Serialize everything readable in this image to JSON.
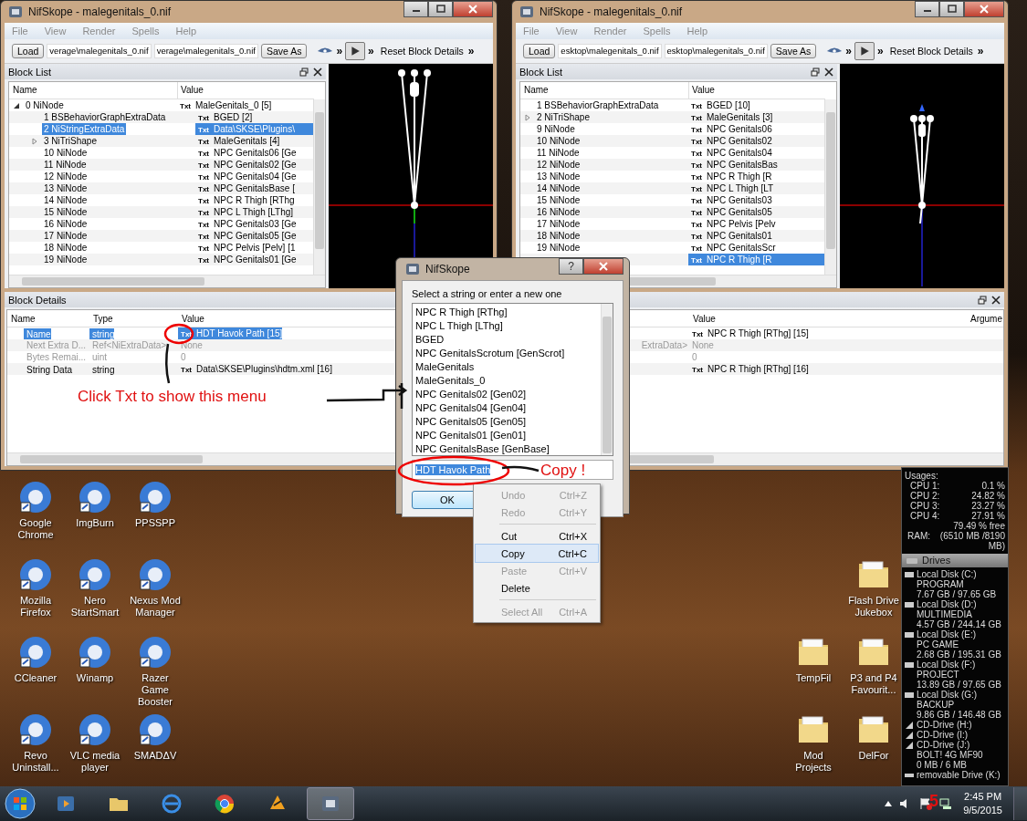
{
  "windows": [
    {
      "title": "NifSkope - malegenitals_0.nif",
      "menu": [
        "File",
        "View",
        "Render",
        "Spells",
        "Help"
      ],
      "toolbar": {
        "load": "Load",
        "path_1": "verage\\malegenitals_0.nif",
        "path_2": "verage\\malegenitals_0.nif",
        "save_as": "Save As",
        "reset": "Reset Block Details",
        "chevrons": [
          "»",
          "»",
          "»"
        ]
      },
      "block_list": {
        "title": "Block List",
        "columns": [
          "Name",
          "Value"
        ],
        "rows": [
          {
            "label": "0 NiNode",
            "value": "MaleGenitals_0 [5]",
            "badge": "Txt",
            "selected": false,
            "expanded": true,
            "children": [
              {
                "label": "1 BSBehaviorGraphExtraData",
                "value": "BGED [2]",
                "badge": "Txt",
                "selected": false
              },
              {
                "label": "2 NiStringExtraData",
                "value": "Data\\SKSE\\Plugins\\",
                "badge": "Txt",
                "selected": true
              },
              {
                "label": "3 NiTriShape",
                "value": "MaleGenitals [4]",
                "badge": "Txt",
                "selected": false,
                "expanded": false
              },
              {
                "label": "10 NiNode",
                "value": "NPC Genitals06 [Ge",
                "badge": "Txt",
                "selected": false
              },
              {
                "label": "11 NiNode",
                "value": "NPC Genitals02 [Ge",
                "badge": "Txt",
                "selected": false
              },
              {
                "label": "12 NiNode",
                "value": "NPC Genitals04 [Ge",
                "badge": "Txt",
                "selected": false
              },
              {
                "label": "13 NiNode",
                "value": "NPC GenitalsBase [",
                "badge": "Txt",
                "selected": false
              },
              {
                "label": "14 NiNode",
                "value": "NPC R Thigh [RThg",
                "badge": "Txt",
                "selected": false
              },
              {
                "label": "15 NiNode",
                "value": "NPC L Thigh [LThg]",
                "badge": "Txt",
                "selected": false
              },
              {
                "label": "16 NiNode",
                "value": "NPC Genitals03 [Ge",
                "badge": "Txt",
                "selected": false
              },
              {
                "label": "17 NiNode",
                "value": "NPC Genitals05 [Ge",
                "badge": "Txt",
                "selected": false
              },
              {
                "label": "18 NiNode",
                "value": "NPC Pelvis [Pelv] [1",
                "badge": "Txt",
                "selected": false
              },
              {
                "label": "19 NiNode",
                "value": "NPC Genitals01 [Ge",
                "badge": "Txt",
                "selected": false
              }
            ]
          }
        ]
      },
      "block_details": {
        "title": "Block Details",
        "columns": [
          {
            "kind": "name",
            "label": "Name"
          },
          {
            "kind": "type",
            "label": "Type"
          },
          {
            "kind": "value",
            "label": "Value"
          }
        ],
        "rows": [
          {
            "name": "Name",
            "type": "string",
            "value": "HDT Havok Path [15]",
            "badge": "Txt",
            "selected": true,
            "disabled": false
          },
          {
            "name": "Next Extra D...",
            "type": "Ref<NiExtraData>",
            "value": "None",
            "selected": false,
            "disabled": true
          },
          {
            "name": "Bytes Remai...",
            "type": "uint",
            "value": "0",
            "selected": false,
            "disabled": true
          },
          {
            "name": "String Data",
            "type": "string",
            "value": "Data\\SKSE\\Plugins\\hdtm.xml [16]",
            "badge": "Txt",
            "selected": false,
            "disabled": false
          }
        ]
      }
    },
    {
      "title": "NifSkope - malegenitals_0.nif",
      "menu": [
        "File",
        "View",
        "Render",
        "Spells",
        "Help"
      ],
      "toolbar": {
        "load": "Load",
        "path_1": "esktop\\malegenitals_0.nif",
        "path_2": "esktop\\malegenitals_0.nif",
        "save_as": "Save As",
        "reset": "Reset Block Details",
        "chevrons": [
          "»",
          "»",
          "»"
        ]
      },
      "block_list": {
        "title": "Block List",
        "columns": [
          "Name",
          "Value"
        ],
        "rows": [
          {
            "label": "1 BSBehaviorGraphExtraData",
            "value": "BGED [10]",
            "badge": "Txt",
            "selected": false
          },
          {
            "label": "2 NiTriShape",
            "value": "MaleGenitals [3]",
            "badge": "Txt",
            "selected": false,
            "expanded": false
          },
          {
            "label": "9 NiNode",
            "value": "NPC Genitals06",
            "badge": "Txt",
            "selected": false
          },
          {
            "label": "10 NiNode",
            "value": "NPC Genitals02",
            "badge": "Txt",
            "selected": false
          },
          {
            "label": "11 NiNode",
            "value": "NPC Genitals04",
            "badge": "Txt",
            "selected": false
          },
          {
            "label": "12 NiNode",
            "value": "NPC GenitalsBas",
            "badge": "Txt",
            "selected": false
          },
          {
            "label": "13 NiNode",
            "value": "NPC R Thigh [R",
            "badge": "Txt",
            "selected": false
          },
          {
            "label": "14 NiNode",
            "value": "NPC L Thigh [LT",
            "badge": "Txt",
            "selected": false
          },
          {
            "label": "15 NiNode",
            "value": "NPC Genitals03",
            "badge": "Txt",
            "selected": false
          },
          {
            "label": "16 NiNode",
            "value": "NPC Genitals05",
            "badge": "Txt",
            "selected": false
          },
          {
            "label": "17 NiNode",
            "value": "NPC Pelvis [Pelv",
            "badge": "Txt",
            "selected": false
          },
          {
            "label": "18 NiNode",
            "value": "NPC Genitals01",
            "badge": "Txt",
            "selected": false
          },
          {
            "label": "19 NiNode",
            "value": "NPC GenitalsScr",
            "badge": "Txt",
            "selected": false
          },
          {
            "value": "NPC R Thigh [R",
            "badge": "Txt",
            "selected": true
          }
        ]
      },
      "block_details": {
        "columns": [
          {
            "kind": "value",
            "label": "Value"
          },
          {
            "kind": "argument",
            "label": "Argume"
          }
        ],
        "rows": [
          {
            "value": "NPC R Thigh [RThg] [15]",
            "badge": "Txt",
            "selected": false,
            "disabled": false
          },
          {
            "type": "ExtraData>",
            "value": "None",
            "selected": false,
            "disabled": true
          },
          {
            "value": "0",
            "selected": false,
            "disabled": true
          },
          {
            "value": "NPC R Thigh [RThg] [16]",
            "badge": "Txt",
            "selected": false,
            "disabled": false
          }
        ]
      }
    }
  ],
  "dialog": {
    "title": "NifSkope",
    "help": "?",
    "prompt": "Select a string or enter a new one",
    "items": [
      {
        "label": "NPC R Thigh [RThg]",
        "selected": false
      },
      {
        "label": "NPC L Thigh [LThg]",
        "selected": false
      },
      {
        "label": "BGED",
        "selected": false
      },
      {
        "label": "NPC GenitalsScrotum [GenScrot]",
        "selected": false
      },
      {
        "label": "MaleGenitals",
        "selected": false
      },
      {
        "label": "MaleGenitals_0",
        "selected": false
      },
      {
        "label": "NPC Genitals02 [Gen02]",
        "selected": false
      },
      {
        "label": "NPC Genitals04 [Gen04]",
        "selected": false
      },
      {
        "label": "NPC Genitals05 [Gen05]",
        "selected": false
      },
      {
        "label": "NPC Genitals01 [Gen01]",
        "selected": false
      },
      {
        "label": "NPC GenitalsBase [GenBase]",
        "selected": false
      }
    ],
    "input": "HDT Havok Path",
    "ok": "OK"
  },
  "context_menu": [
    {
      "kind": "item",
      "label": "Undo",
      "shortcut": "Ctrl+Z",
      "disabled": true,
      "selected": false
    },
    {
      "kind": "item",
      "label": "Redo",
      "shortcut": "Ctrl+Y",
      "disabled": true,
      "selected": false
    },
    {
      "kind": "separator"
    },
    {
      "kind": "item",
      "label": "Cut",
      "shortcut": "Ctrl+X",
      "disabled": false,
      "selected": false
    },
    {
      "kind": "item",
      "label": "Copy",
      "shortcut": "Ctrl+C",
      "disabled": false,
      "selected": true
    },
    {
      "kind": "item",
      "label": "Paste",
      "shortcut": "Ctrl+V",
      "disabled": true,
      "selected": false
    },
    {
      "kind": "item",
      "label": "Delete",
      "disabled": false,
      "selected": false
    },
    {
      "kind": "separator"
    },
    {
      "kind": "item",
      "label": "Select All",
      "shortcut": "Ctrl+A",
      "disabled": true,
      "selected": false
    }
  ],
  "desktop_icons": [
    {
      "label": "Google Chrome",
      "kind": "app"
    },
    {
      "label": "Mozilla Firefox",
      "kind": "app"
    },
    {
      "label": "CCleaner",
      "kind": "app"
    },
    {
      "label": "Revo Uninstall...",
      "kind": "app"
    },
    {
      "label": "ImgBurn",
      "kind": "app"
    },
    {
      "label": "Nero StartSmart",
      "kind": "app"
    },
    {
      "label": "Winamp",
      "kind": "app"
    },
    {
      "label": "VLC media player",
      "kind": "app"
    },
    {
      "label": "PPSSPP",
      "kind": "app"
    },
    {
      "label": "Nexus Mod Manager",
      "kind": "app"
    },
    {
      "label": "Razer Game Booster",
      "kind": "app"
    },
    {
      "label": "SMADΔV",
      "kind": "app"
    },
    {
      "label": "TempFil",
      "kind": "folder"
    },
    {
      "label": "Mod Projects",
      "kind": "folder"
    },
    {
      "label": "Flash Drive Jukebox",
      "kind": "folder"
    },
    {
      "label": "P3 and P4 Favourit...",
      "kind": "folder"
    },
    {
      "label": "DelFor",
      "kind": "folder"
    }
  ],
  "gadget": {
    "usages": "Usages:",
    "cpus": [
      {
        "label": "CPU 1:",
        "value": "0.1 %"
      },
      {
        "label": "CPU 2:",
        "value": "24.82 %"
      },
      {
        "label": "CPU 3:",
        "value": "23.27 %"
      },
      {
        "label": "CPU 4:",
        "value": "27.91 %"
      }
    ],
    "free": "79.49 % free",
    "ram_label": "RAM:",
    "ram_value": "(6510 MB /8190 MB)",
    "drives_title": "Drives",
    "drives": [
      {
        "kind": "disk",
        "name": "Local Disk (C:)",
        "label": "PROGRAM",
        "usage": "7.67 GB / 97.65 GB"
      },
      {
        "kind": "disk",
        "name": "Local Disk (D:)",
        "label": "MULTIMEDIA",
        "usage": "4.57 GB / 244.14 GB"
      },
      {
        "kind": "disk",
        "name": "Local Disk (E:)",
        "label": "PC GAME",
        "usage": "2.68 GB / 195.31 GB"
      },
      {
        "kind": "disk",
        "name": "Local Disk (F:)",
        "label": "PROJECT",
        "usage": "13.89 GB / 97.65 GB"
      },
      {
        "kind": "disk",
        "name": "Local Disk (G:)",
        "label": "BACKUP",
        "usage": "9.86 GB / 146.48 GB"
      },
      {
        "kind": "cd",
        "name": "CD-Drive (H:)"
      },
      {
        "kind": "cd",
        "name": "CD-Drive (I:)"
      },
      {
        "kind": "cd",
        "name": "CD-Drive (J:)",
        "label": "BOLT! 4G MF90",
        "usage": "0 MB / 6 MB"
      },
      {
        "kind": "removable",
        "name": "removable Drive (K:)"
      }
    ]
  },
  "taskbar": {
    "time": "2:45 PM",
    "date": "9/5/2015"
  },
  "annotations": [
    {
      "kind": "label",
      "text": "Click Txt to show this menu"
    },
    {
      "kind": "label",
      "text": "Copy !"
    },
    {
      "kind": "label",
      "text": "5"
    },
    {
      "kind": "circle"
    },
    {
      "kind": "circle"
    },
    {
      "kind": "line"
    },
    {
      "kind": "arrow"
    },
    {
      "kind": "line"
    }
  ]
}
